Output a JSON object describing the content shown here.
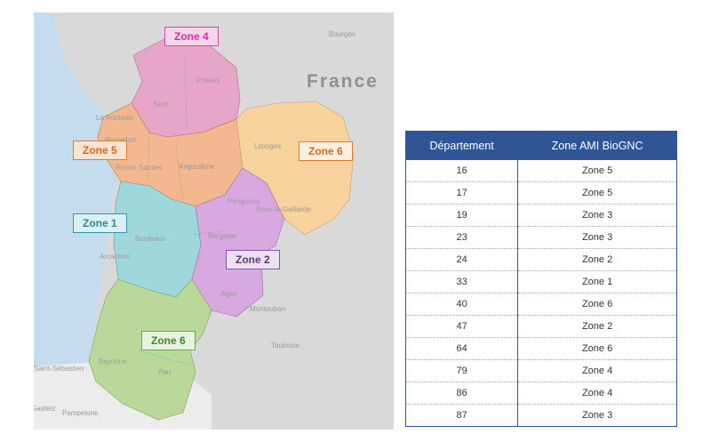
{
  "map": {
    "country_label": "France",
    "place_labels": [
      "Bourges",
      "Poitiers",
      "Niort",
      "La Rochelle",
      "Rochefort",
      "Royan",
      "Saintes",
      "Angoulême",
      "Limoges",
      "Périgueux",
      "Brive-la-Gaillarde",
      "Bergerac",
      "Bordeaux",
      "Arcachon",
      "Agen",
      "Montauban",
      "Toulouse",
      "Saint-Sébastien",
      "Bayonne",
      "Pau",
      "Pampelune",
      "Vitoria-Gasteiz"
    ],
    "zones": [
      {
        "label": "Zone 4",
        "color": "#e040a8",
        "fill": "#e7a6c8"
      },
      {
        "label": "Zone 5",
        "color": "#e07a30",
        "fill": "#f3b88f"
      },
      {
        "label": "Zone 6",
        "color": "#e07a30",
        "fill": "#f8d29c"
      },
      {
        "label": "Zone 1",
        "color": "#2f9aa8",
        "fill": "#9fd8dc"
      },
      {
        "label": "Zone 2",
        "color": "#8a4fb0",
        "fill": "#d7a9e0"
      },
      {
        "label": "Zone 6",
        "color": "#6aa84f",
        "fill": "#b9d89a"
      }
    ]
  },
  "table": {
    "headers": [
      "Département",
      "Zone AMI BioGNC"
    ],
    "rows": [
      [
        "16",
        "Zone 5"
      ],
      [
        "17",
        "Zone 5"
      ],
      [
        "19",
        "Zone 3"
      ],
      [
        "23",
        "Zone 3"
      ],
      [
        "24",
        "Zone 2"
      ],
      [
        "33",
        "Zone 1"
      ],
      [
        "40",
        "Zone 6"
      ],
      [
        "47",
        "Zone 2"
      ],
      [
        "64",
        "Zone 6"
      ],
      [
        "79",
        "Zone 4"
      ],
      [
        "86",
        "Zone 4"
      ],
      [
        "87",
        "Zone 3"
      ]
    ],
    "header_color": "#2f5597"
  }
}
